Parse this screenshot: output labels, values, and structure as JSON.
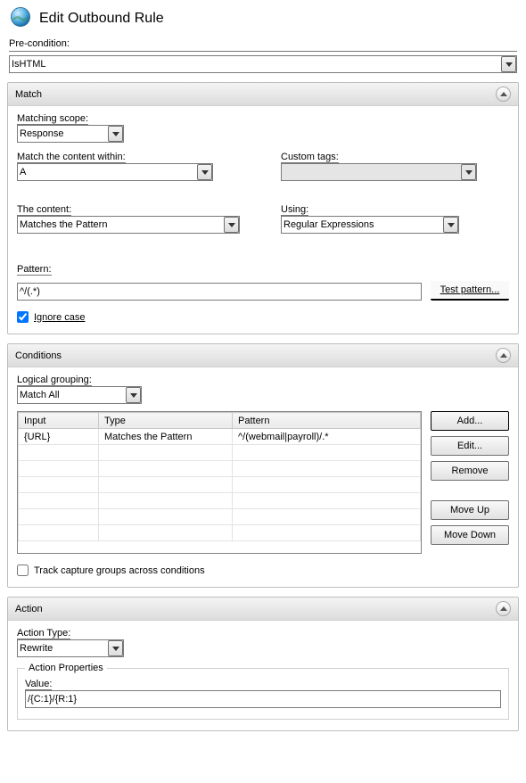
{
  "title": "Edit Outbound Rule",
  "precondition": {
    "label": "Pre-condition:",
    "value": "IsHTML"
  },
  "match": {
    "header": "Match",
    "scope_label": "Matching scope:",
    "scope_value": "Response",
    "content_within_label": "Match the content within:",
    "content_within_value": "A",
    "custom_tags_label": "Custom tags:",
    "custom_tags_value": "",
    "the_content_label": "The content:",
    "the_content_value": "Matches the Pattern",
    "using_label": "Using:",
    "using_value": "Regular Expressions",
    "pattern_label": "Pattern:",
    "pattern_value": "^/(.*)",
    "test_pattern_label": "Test pattern...",
    "ignore_case_label": "Ignore case",
    "ignore_case_checked": true
  },
  "conditions": {
    "header": "Conditions",
    "logical_grouping_label": "Logical grouping:",
    "logical_grouping_value": "Match All",
    "columns": {
      "input": "Input",
      "type": "Type",
      "pattern": "Pattern"
    },
    "rows": [
      {
        "input": "{URL}",
        "type": "Matches the Pattern",
        "pattern": "^/(webmail|payroll)/.*"
      }
    ],
    "buttons": {
      "add": "Add...",
      "edit": "Edit...",
      "remove": "Remove",
      "move_up": "Move Up",
      "move_down": "Move Down"
    },
    "track_capture_label": "Track capture groups across conditions",
    "track_capture_checked": false
  },
  "action": {
    "header": "Action",
    "action_type_label": "Action Type:",
    "action_type_value": "Rewrite",
    "properties_legend": "Action Properties",
    "value_label": "Value:",
    "value_value": "/{C:1}/{R:1}"
  }
}
